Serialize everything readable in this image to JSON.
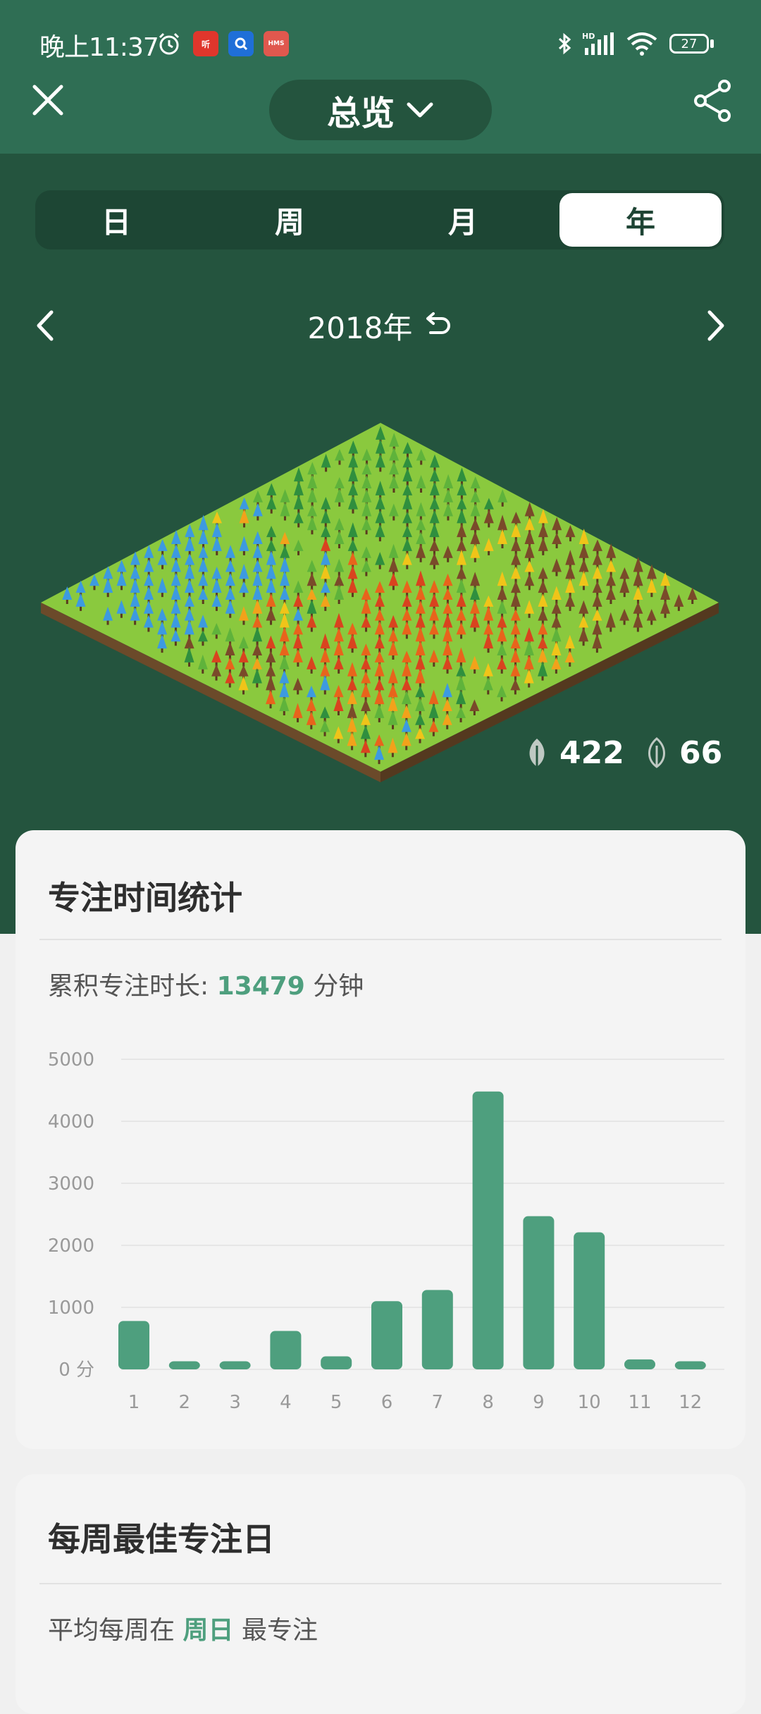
{
  "status_bar": {
    "time": "晚上11:37",
    "network": "HD",
    "battery": "27",
    "icons": [
      "alarm-icon",
      "listen-app-icon",
      "search-app-icon",
      "hms-app-icon",
      "bluetooth-icon",
      "signal-icon",
      "wifi-icon",
      "battery-icon"
    ]
  },
  "app_bar": {
    "title": "总览",
    "icons": [
      "close-icon",
      "chevron-down-icon",
      "share-icon"
    ]
  },
  "tabs": [
    "日",
    "周",
    "月",
    "年"
  ],
  "active_tab": "年",
  "date_nav": {
    "label": "2018年",
    "icons": [
      "chevron-left-icon",
      "reset-icon",
      "chevron-right-icon"
    ]
  },
  "forest_counts": {
    "healthy_trees": "422",
    "dead_trees": "66"
  },
  "focus_card": {
    "title": "专注时间统计",
    "total_label": "累积专注时长:",
    "total_value": "13479",
    "total_unit": "分钟"
  },
  "chart_data": {
    "type": "bar",
    "categories": [
      "1",
      "2",
      "3",
      "4",
      "5",
      "6",
      "7",
      "8",
      "9",
      "10",
      "11",
      "12"
    ],
    "values": [
      780,
      130,
      130,
      620,
      210,
      1100,
      1280,
      4480,
      2470,
      2210,
      160,
      130
    ],
    "ytick_labels": [
      "0 分",
      "1000",
      "2000",
      "3000",
      "4000",
      "5000"
    ],
    "yticks": [
      0,
      1000,
      2000,
      3000,
      4000,
      5000
    ],
    "ylim": [
      0,
      5000
    ],
    "bar_color": "#4e9f7e",
    "grid": true
  },
  "weekly_card": {
    "title": "每周最佳专注日",
    "line_prefix": "平均每周在",
    "best_day": "周日",
    "line_suffix": "最专注"
  },
  "colors": {
    "header": "#2f6e54",
    "background_dark": "#24543e",
    "accent": "#4e9f7e",
    "card": "#f4f4f4"
  }
}
